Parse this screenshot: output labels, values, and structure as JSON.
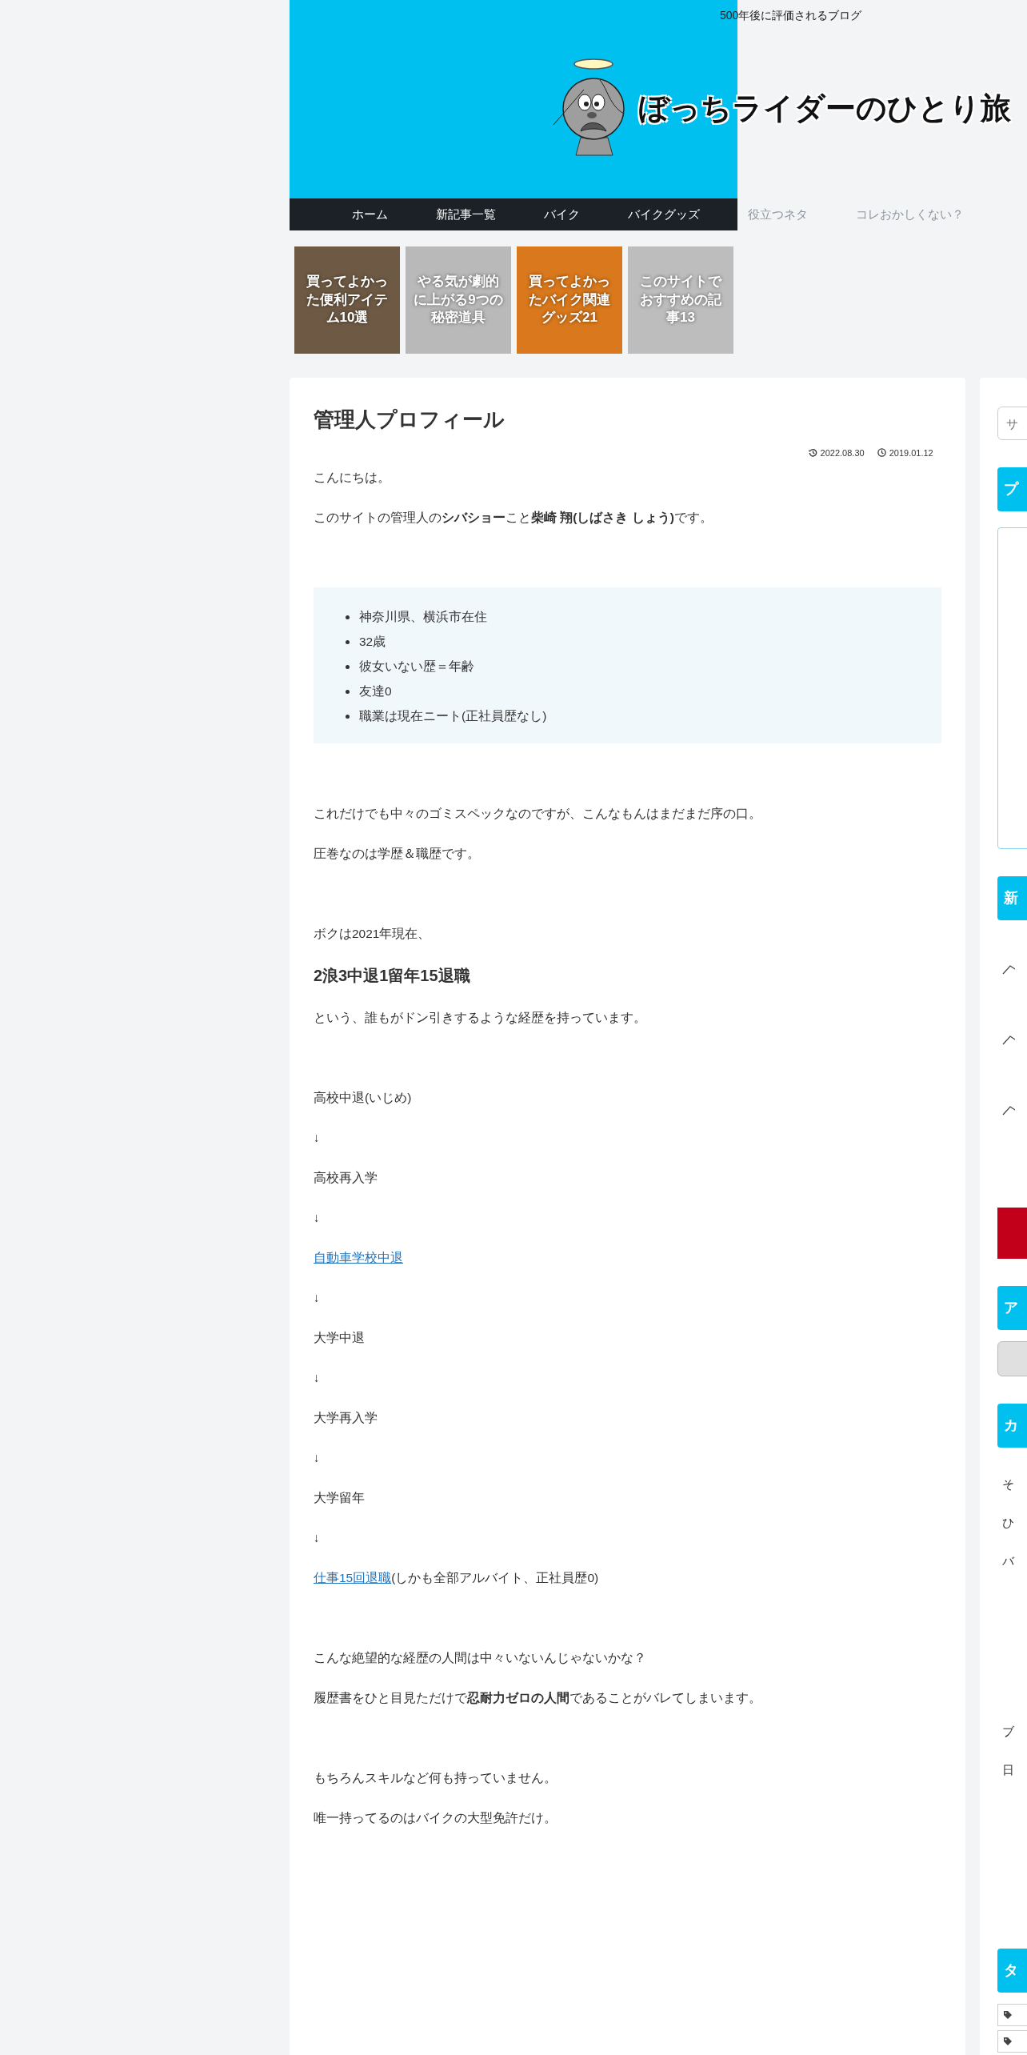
{
  "header": {
    "tagline": "500年後に評価されるブログ",
    "logo_text": "ぼっちライダーのひとり旅"
  },
  "nav": [
    {
      "label": "ホーム"
    },
    {
      "label": "新記事一覧"
    },
    {
      "label": "バイク"
    },
    {
      "label": "バイクグッズ"
    },
    {
      "label": "役立つネタ"
    },
    {
      "label": "コレおかしくない？"
    }
  ],
  "featured": [
    {
      "title": "買ってよかった便利アイテム10選",
      "color": "#6e5a44"
    },
    {
      "title": "やる気が劇的に上がる9つの秘密道具",
      "color": "#b9b9b9"
    },
    {
      "title": "買ってよかったバイク関連グッズ21",
      "color": "#d9781c"
    },
    {
      "title": "このサイトでおすすめの記事13",
      "color": "#bdbdbd"
    }
  ],
  "article": {
    "title": "管理人プロフィール",
    "updated": "2022.08.30",
    "published": "2019.01.12",
    "intro": [
      "こんにちは。",
      "このサイトの管理人の**シバショー**こと**柴崎 翔(しばさき しょう)**です。"
    ],
    "list": [
      "神奈川県、横浜市在住",
      "32歳",
      "彼女いない歴＝年齢",
      "友達0",
      "職業は現在ニート(正社員歴なし)"
    ],
    "sections": [
      [
        {
          "kind": "text",
          "text": "これだけでも中々のゴミスペックなのですが、こんなもんはまだまだ序の口。"
        },
        {
          "kind": "text",
          "text": "圧巻なのは学歴＆職歴です。"
        }
      ],
      [
        {
          "kind": "text",
          "text": "ボクは2021年現在、"
        },
        {
          "kind": "heading",
          "text": "2浪3中退1留年15退職"
        },
        {
          "kind": "text",
          "text": "という、誰もがドン引きするような経歴を持っています。"
        }
      ],
      [
        {
          "kind": "text",
          "text": "高校中退(いじめ)"
        },
        {
          "kind": "text",
          "text": "↓"
        },
        {
          "kind": "text",
          "text": "高校再入学"
        },
        {
          "kind": "text",
          "text": "↓"
        },
        {
          "kind": "link",
          "text": "自動車学校中退"
        },
        {
          "kind": "text",
          "text": "↓"
        },
        {
          "kind": "text",
          "text": "大学中退"
        },
        {
          "kind": "text",
          "text": "↓"
        },
        {
          "kind": "text",
          "text": "大学再入学"
        },
        {
          "kind": "text",
          "text": "↓"
        },
        {
          "kind": "text",
          "text": "大学留年"
        },
        {
          "kind": "text",
          "text": "↓"
        },
        {
          "kind": "link",
          "text": "仕事15回退職",
          "after": "(しかも全部アルバイト、正社員歴0)"
        }
      ],
      [
        {
          "kind": "text",
          "text": "こんな絶望的な経歴の人間は中々いないんじゃないかな？"
        },
        {
          "kind": "text",
          "text": "履歴書をひと目見ただけで**忍耐力ゼロの人間**であることがバレてしまいます。"
        }
      ],
      [
        {
          "kind": "text",
          "text": "もちろんスキルなど何も持っていません。"
        },
        {
          "kind": "text",
          "text": "唯一持ってるのはバイクの大型免許だけ。"
        }
      ]
    ]
  },
  "sidebar": {
    "search_placeholder": "サ",
    "widgets": [
      {
        "kind": "box",
        "heading": "プ"
      },
      {
        "kind": "recent",
        "heading": "新"
      },
      {
        "kind": "archive",
        "heading": "ア"
      },
      {
        "kind": "text",
        "heading": "カ",
        "groups": [
          [
            "そ",
            "ひ",
            "バ"
          ],
          [
            "ブ",
            "日"
          ]
        ]
      },
      {
        "kind": "tags",
        "heading": "タ"
      }
    ]
  }
}
